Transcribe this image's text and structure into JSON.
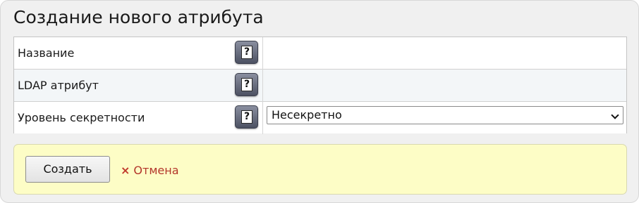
{
  "page": {
    "title": "Создание нового атрибута"
  },
  "form": {
    "rows": [
      {
        "label": "Название",
        "value": ""
      },
      {
        "label": "LDAP атрибут",
        "value": ""
      },
      {
        "label": "Уровень секретности",
        "value": "Несекретно"
      }
    ],
    "help_glyph": "?"
  },
  "actions": {
    "create_label": "Создать",
    "cancel_label": "Отмена",
    "cancel_icon": "×"
  },
  "colors": {
    "panel_bg": "#f0f0f0",
    "actions_bg": "#fdfdc6",
    "cancel_red": "#b3362b",
    "alt_row_bg": "#f3f6f8"
  }
}
